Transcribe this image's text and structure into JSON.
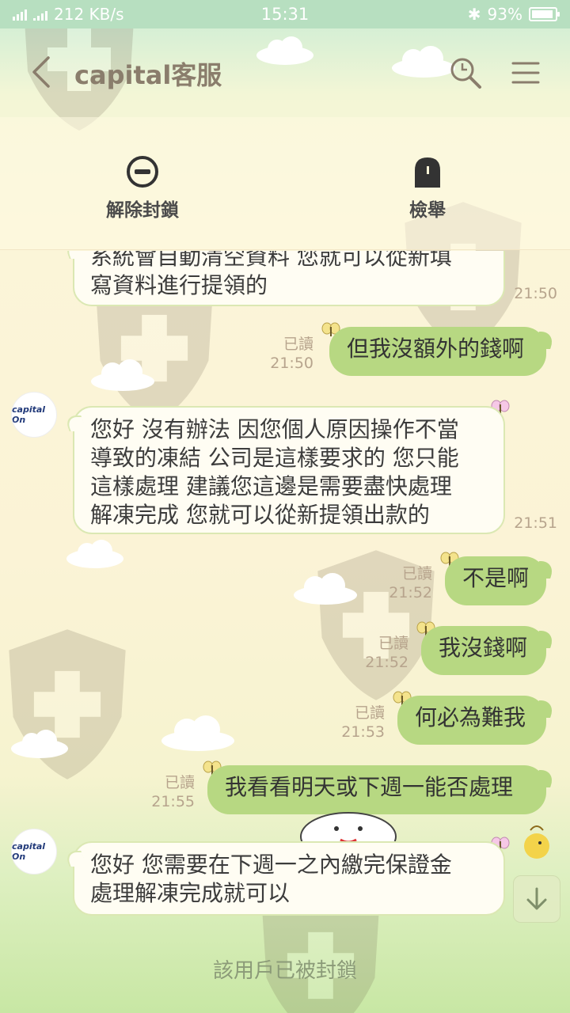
{
  "status_bar": {
    "network_type": "4G",
    "speed": "212 KB/s",
    "time": "15:31",
    "battery": "93%",
    "battery_level": 0.93
  },
  "header": {
    "title": "capital客服",
    "back_icon": "chevron-left-icon",
    "search_icon": "search-icon",
    "menu_icon": "hamburger-menu-icon"
  },
  "actions": {
    "unblock_label": "解除封鎖",
    "report_label": "檢舉"
  },
  "avatar_text": "capital On",
  "messages": [
    {
      "side": "recv",
      "text": "系統會自動清空資料 您就可以從新填寫資料進行提領的",
      "lines": [
        "系統會自動清空資料 您就可以從新填",
        "寫資料進行提領的"
      ],
      "time": "21:50"
    },
    {
      "side": "sent",
      "text": "但我沒額外的錢啊",
      "read": "已讀",
      "time": "21:50"
    },
    {
      "side": "recv",
      "lines": [
        "您好 沒有辦法 因您個人原因操作不當",
        "導致的凍結 公司是這樣要求的 您只能",
        "這樣處理 建議您這邊是需要盡快處理",
        "解凍完成 您就可以從新提領出款的"
      ],
      "time": "21:51"
    },
    {
      "side": "sent",
      "text": "不是啊",
      "read": "已讀",
      "time": "21:52"
    },
    {
      "side": "sent",
      "text": "我沒錢啊",
      "read": "已讀",
      "time": "21:52"
    },
    {
      "side": "sent",
      "text": "何必為難我",
      "read": "已讀",
      "time": "21:53"
    },
    {
      "side": "sent",
      "text": "我看看明天或下週一能否處理",
      "read": "已讀",
      "time": "21:55"
    },
    {
      "side": "recv",
      "lines": [
        "您好 您需要在下週一之內繳完保證金",
        "處理解凍完成就可以"
      ],
      "time": ""
    }
  ],
  "footer": {
    "blocked_notice": "該用戶已被封鎖"
  },
  "colors": {
    "sent_bubble": "#b7d882",
    "recv_bubble": "#fffdf3",
    "title": "#8a7d6c",
    "status_bar": "#b7dfc0"
  }
}
